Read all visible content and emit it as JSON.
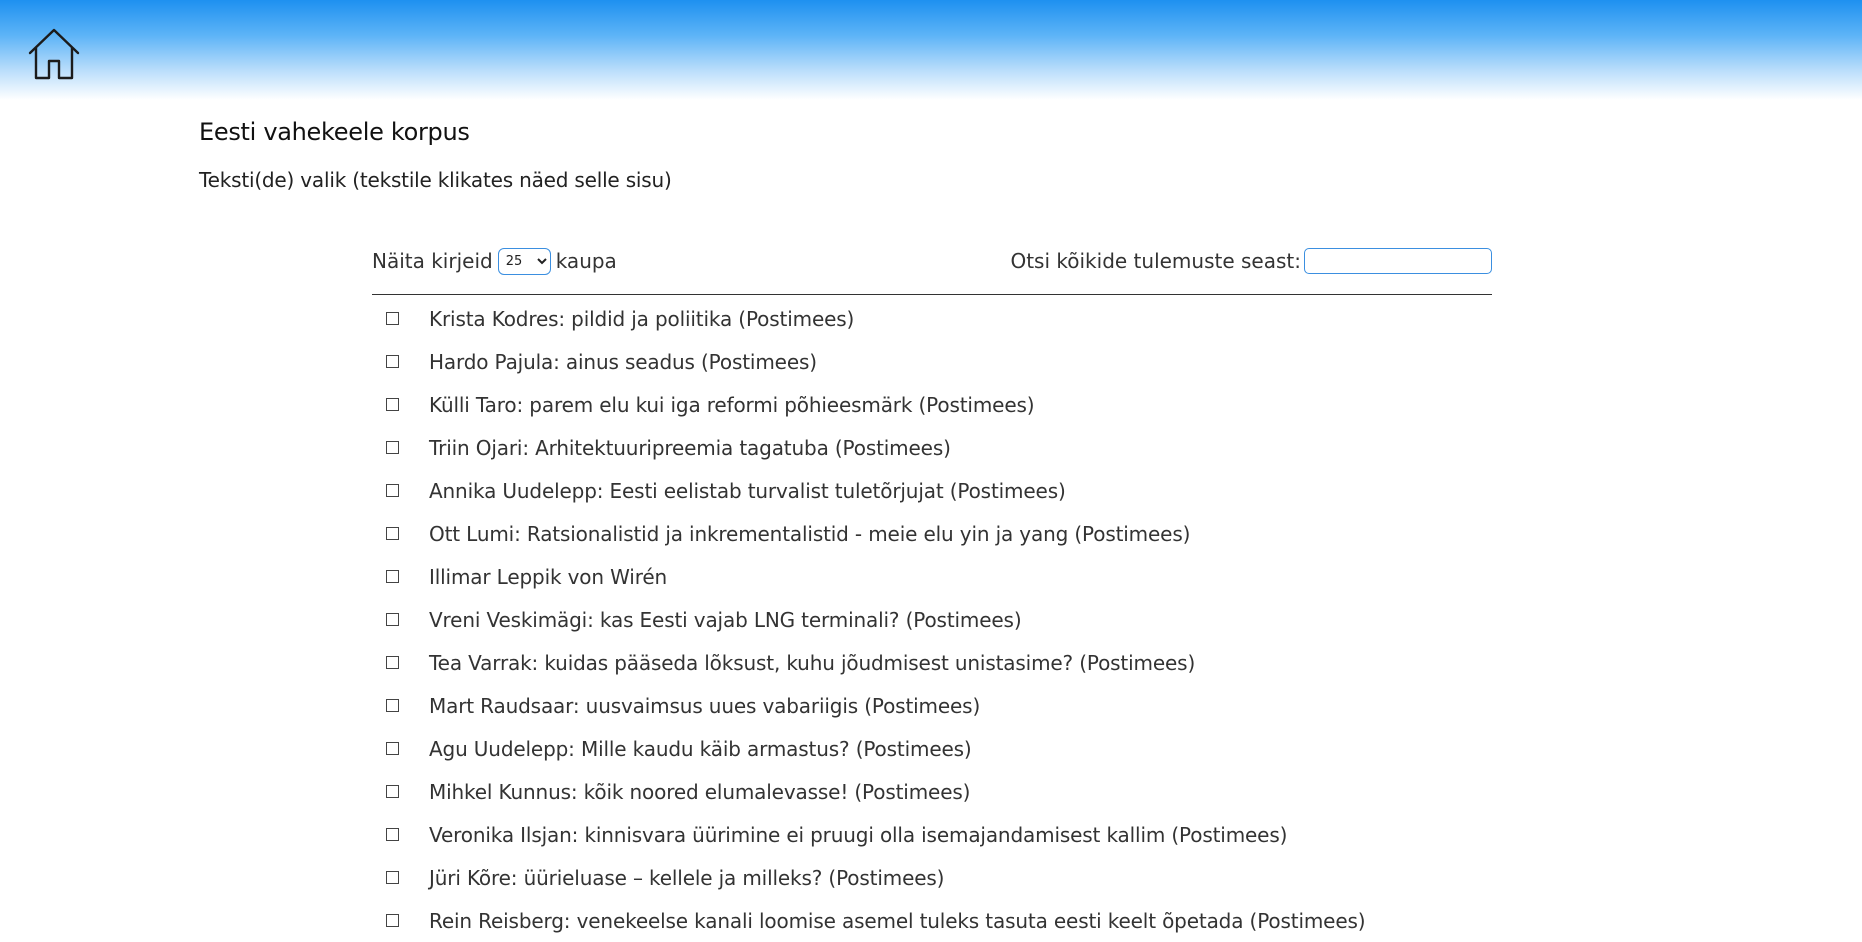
{
  "header": {
    "home_icon": "home-icon"
  },
  "page": {
    "title": "Eesti vahekeele korpus",
    "subtitle": "Teksti(de) valik (tekstile klikates näed selle sisu)"
  },
  "controls": {
    "show_label_before": "Näita kirjeid",
    "page_size_selected": "25",
    "show_label_after": "kaupa",
    "search_label": "Otsi kõikide tulemuste seast:",
    "search_value": ""
  },
  "texts": [
    "Krista Kodres: pildid ja poliitika (Postimees)",
    "Hardo Pajula: ainus seadus (Postimees)",
    "Külli Taro: parem elu kui iga reformi põhieesmärk (Postimees)",
    "Triin Ojari: Arhitektuuripreemia tagatuba (Postimees)",
    "Annika Uudelepp: Eesti eelistab turvalist tuletõrjujat (Postimees)",
    "Ott Lumi: Ratsionalistid ja inkrementalistid - meie elu yin ja yang (Postimees)",
    "Illimar Leppik von Wirén",
    "Vreni Veskimägi: kas Eesti vajab LNG terminali? (Postimees)",
    "Tea Varrak: kuidas pääseda lõksust, kuhu jõudmisest unistasime? (Postimees)",
    "Mart Raudsaar: uusvaimsus uues vabariigis (Postimees)",
    "Agu Uudelepp: Mille kaudu käib armastus? (Postimees)",
    "Mihkel Kunnus: kõik noored elumalevasse! (Postimees)",
    "Veronika Ilsjan: kinnisvara üürimine ei pruugi olla isemajandamisest kallim (Postimees)",
    "Jüri Kõre: üürieluase – kellele ja milleks? (Postimees)",
    "Rein Reisberg: venekeelse kanali loomise asemel tuleks tasuta eesti keelt õpetada (Postimees)"
  ]
}
